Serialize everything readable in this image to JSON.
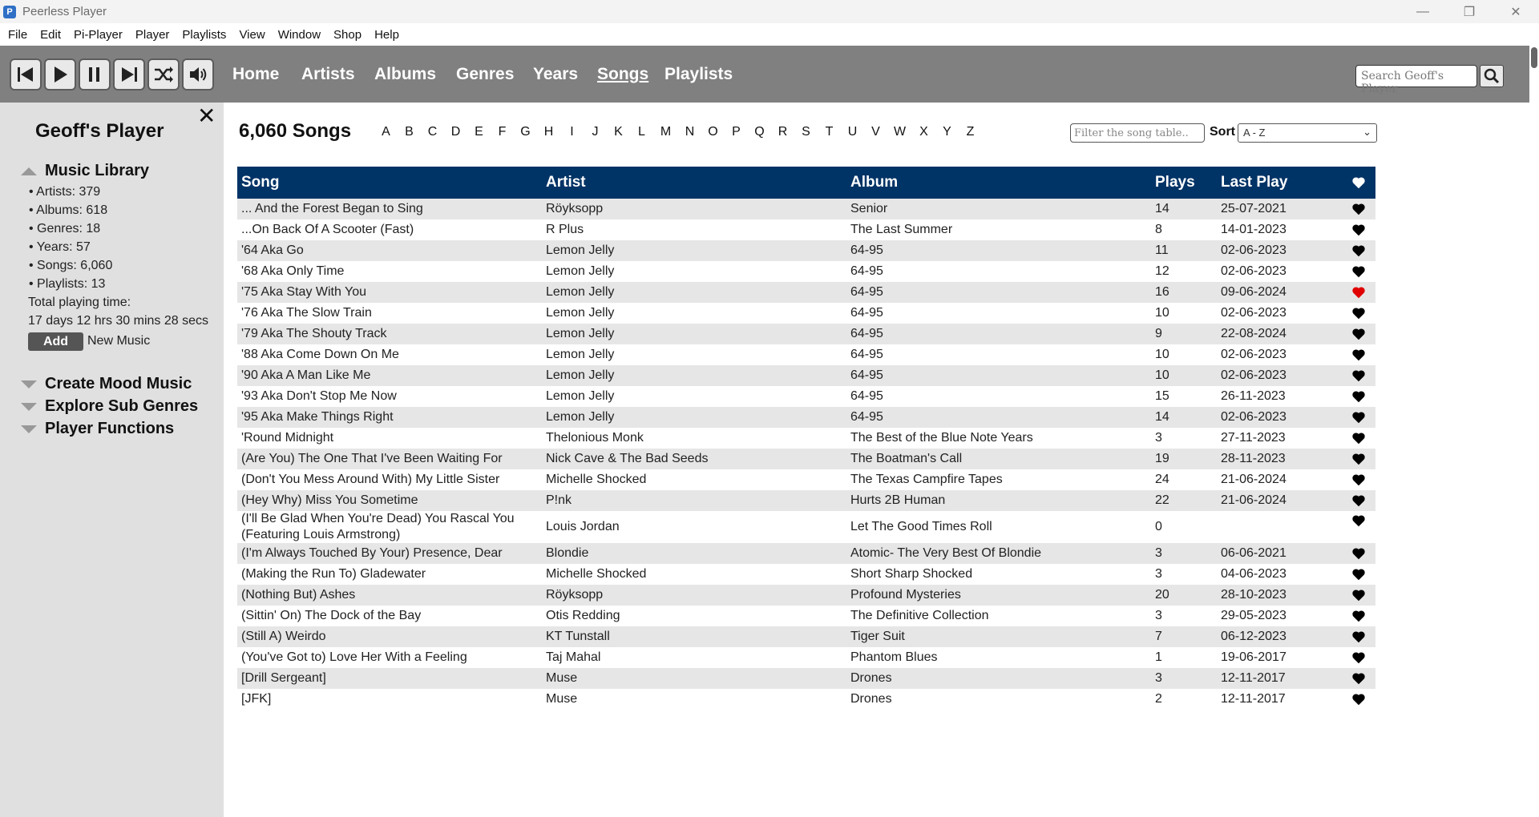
{
  "window": {
    "title": "Peerless Player",
    "app_icon": "P"
  },
  "menubar": [
    "File",
    "Edit",
    "Pi-Player",
    "Player",
    "Playlists",
    "View",
    "Window",
    "Shop",
    "Help"
  ],
  "nav": {
    "home": "Home",
    "artists": "Artists",
    "albums": "Albums",
    "genres": "Genres",
    "years": "Years",
    "songs": "Songs",
    "playlists": "Playlists",
    "active": "Songs"
  },
  "search": {
    "placeholder": "Search Geoff's Player"
  },
  "sidebar": {
    "title": "Geoff's Player",
    "close": "✕",
    "library_heading": "Music Library",
    "stats": [
      "• Artists: 379",
      "• Albums: 618",
      "• Genres: 18",
      "• Years: 57",
      "• Songs: 6,060",
      "• Playlists: 13"
    ],
    "total_label": "Total playing time:",
    "total_value": "17 days 12 hrs 30 mins 28 secs",
    "add_button": "Add",
    "add_label": "New Music",
    "sections": [
      "Create Mood Music",
      "Explore Sub Genres",
      "Player Functions"
    ]
  },
  "main": {
    "count_title": "6,060 Songs",
    "letters": [
      "A",
      "B",
      "C",
      "D",
      "E",
      "F",
      "G",
      "H",
      "I",
      "J",
      "K",
      "L",
      "M",
      "N",
      "O",
      "P",
      "Q",
      "R",
      "S",
      "T",
      "U",
      "V",
      "W",
      "X",
      "Y",
      "Z"
    ],
    "filter_placeholder": "Filter the song table..",
    "sort_label": "Sort",
    "sort_value": "A - Z"
  },
  "table": {
    "headers": {
      "song": "Song",
      "artist": "Artist",
      "album": "Album",
      "plays": "Plays",
      "last_play": "Last Play"
    },
    "colors": {
      "header_bg": "#003366",
      "favourite": "#e00000",
      "heart": "#000000"
    },
    "rows": [
      {
        "song": "... And the Forest Began to Sing",
        "artist": "Röyksopp",
        "album": "Senior",
        "plays": "14",
        "last": "25-07-2021",
        "fav": false
      },
      {
        "song": "...On Back Of A Scooter (Fast)",
        "artist": "R Plus",
        "album": "The Last Summer",
        "plays": "8",
        "last": "14-01-2023",
        "fav": false
      },
      {
        "song": "'64 Aka Go",
        "artist": "Lemon Jelly",
        "album": "64-95",
        "plays": "11",
        "last": "02-06-2023",
        "fav": false
      },
      {
        "song": "'68 Aka Only Time",
        "artist": "Lemon Jelly",
        "album": "64-95",
        "plays": "12",
        "last": "02-06-2023",
        "fav": false
      },
      {
        "song": "'75 Aka Stay With You",
        "artist": "Lemon Jelly",
        "album": "64-95",
        "plays": "16",
        "last": "09-06-2024",
        "fav": true
      },
      {
        "song": "'76 Aka The Slow Train",
        "artist": "Lemon Jelly",
        "album": "64-95",
        "plays": "10",
        "last": "02-06-2023",
        "fav": false
      },
      {
        "song": "'79 Aka The Shouty Track",
        "artist": "Lemon Jelly",
        "album": "64-95",
        "plays": "9",
        "last": "22-08-2024",
        "fav": false
      },
      {
        "song": "'88 Aka Come Down On Me",
        "artist": "Lemon Jelly",
        "album": "64-95",
        "plays": "10",
        "last": "02-06-2023",
        "fav": false
      },
      {
        "song": "'90 Aka A Man Like Me",
        "artist": "Lemon Jelly",
        "album": "64-95",
        "plays": "10",
        "last": "02-06-2023",
        "fav": false
      },
      {
        "song": "'93 Aka Don't Stop Me Now",
        "artist": "Lemon Jelly",
        "album": "64-95",
        "plays": "15",
        "last": "26-11-2023",
        "fav": false
      },
      {
        "song": "'95 Aka Make Things Right",
        "artist": "Lemon Jelly",
        "album": "64-95",
        "plays": "14",
        "last": "02-06-2023",
        "fav": false
      },
      {
        "song": "'Round Midnight",
        "artist": "Thelonious Monk",
        "album": "The Best of the Blue Note Years",
        "plays": "3",
        "last": "27-11-2023",
        "fav": false
      },
      {
        "song": "(Are You) The One That I've Been Waiting For",
        "artist": "Nick Cave & The Bad Seeds",
        "album": "The Boatman's Call",
        "plays": "19",
        "last": "28-11-2023",
        "fav": false
      },
      {
        "song": "(Don't You Mess Around With) My Little Sister",
        "artist": "Michelle Shocked",
        "album": "The Texas Campfire Tapes",
        "plays": "24",
        "last": "21-06-2024",
        "fav": false
      },
      {
        "song": "(Hey Why) Miss You Sometime",
        "artist": "P!nk",
        "album": "Hurts 2B Human",
        "plays": "22",
        "last": "21-06-2024",
        "fav": false
      },
      {
        "song": "(I'll Be Glad When You're Dead) You Rascal You (Featuring Louis Armstrong)",
        "artist": "Louis Jordan",
        "album": "Let The Good Times Roll",
        "plays": "0",
        "last": "",
        "fav": false,
        "tall": true
      },
      {
        "song": "(I'm Always Touched By Your) Presence, Dear",
        "artist": "Blondie",
        "album": "Atomic- The Very Best Of Blondie",
        "plays": "3",
        "last": "06-06-2021",
        "fav": false
      },
      {
        "song": "(Making the Run To) Gladewater",
        "artist": "Michelle Shocked",
        "album": "Short Sharp Shocked",
        "plays": "3",
        "last": "04-06-2023",
        "fav": false
      },
      {
        "song": "(Nothing But) Ashes",
        "artist": "Röyksopp",
        "album": "Profound Mysteries",
        "plays": "20",
        "last": "28-10-2023",
        "fav": false
      },
      {
        "song": "(Sittin' On) The Dock of the Bay",
        "artist": "Otis Redding",
        "album": "The Definitive Collection",
        "plays": "3",
        "last": "29-05-2023",
        "fav": false
      },
      {
        "song": "(Still A) Weirdo",
        "artist": "KT Tunstall",
        "album": "Tiger Suit",
        "plays": "7",
        "last": "06-12-2023",
        "fav": false
      },
      {
        "song": "(You've Got to) Love Her With a Feeling",
        "artist": "Taj Mahal",
        "album": "Phantom Blues",
        "plays": "1",
        "last": "19-06-2017",
        "fav": false
      },
      {
        "song": "[Drill Sergeant]",
        "artist": "Muse",
        "album": "Drones",
        "plays": "3",
        "last": "12-11-2017",
        "fav": false
      },
      {
        "song": "[JFK]",
        "artist": "Muse",
        "album": "Drones",
        "plays": "2",
        "last": "12-11-2017",
        "fav": false
      }
    ]
  }
}
